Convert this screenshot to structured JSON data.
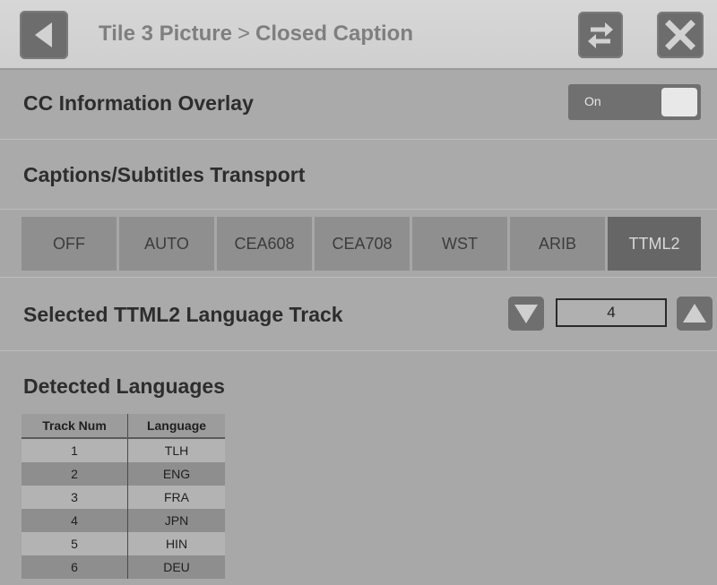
{
  "header": {
    "title_part1": "Tile 3 Picture",
    "separator": ">",
    "title_part2": "Closed Caption",
    "back_icon": "back-arrow-icon",
    "swap_icon": "swap-arrows-icon",
    "close_icon": "close-x-icon"
  },
  "overlay": {
    "label": "CC Information Overlay",
    "toggle_text": "On"
  },
  "transport": {
    "label": "Captions/Subtitles Transport",
    "options": [
      "OFF",
      "AUTO",
      "CEA608",
      "CEA708",
      "WST",
      "ARIB",
      "TTML2"
    ],
    "selected": "TTML2"
  },
  "track": {
    "label": "Selected TTML2 Language Track",
    "value": "4"
  },
  "detected": {
    "label": "Detected Languages",
    "headers": [
      "Track Num",
      "Language"
    ],
    "rows": [
      [
        "1",
        "TLH"
      ],
      [
        "2",
        "ENG"
      ],
      [
        "3",
        "FRA"
      ],
      [
        "4",
        "JPN"
      ],
      [
        "5",
        "HIN"
      ],
      [
        "6",
        "DEU"
      ]
    ]
  },
  "colors": {
    "selected_segment": "#666666",
    "segment": "#8f8f8f",
    "button": "#6d6d6d"
  }
}
